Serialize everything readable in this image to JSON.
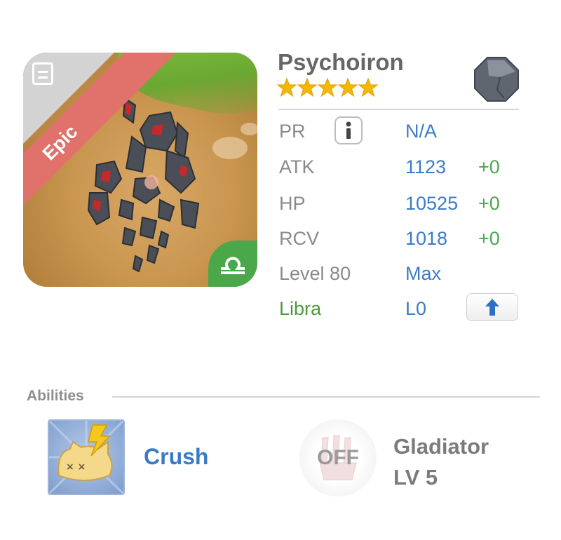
{
  "monster": {
    "name": "Psychoiron",
    "rarity": "Epic",
    "stars": 5,
    "element_icon": "stone-element-icon",
    "zodiac_icon": "libra-icon"
  },
  "stats": {
    "pr": {
      "label": "PR",
      "value": "N/A"
    },
    "atk": {
      "label": "ATK",
      "value": "1123",
      "bonus": "+0"
    },
    "hp": {
      "label": "HP",
      "value": "10525",
      "bonus": "+0"
    },
    "rcv": {
      "label": "RCV",
      "value": "1018",
      "bonus": "+0"
    },
    "level": {
      "label": "Level 80",
      "value": "Max"
    },
    "zodiac": {
      "label": "Libra",
      "value": "L0"
    }
  },
  "abilities": {
    "title": "Abilities",
    "active": {
      "name": "Crush"
    },
    "passive": {
      "status": "OFF",
      "name": "Gladiator",
      "level": "LV 5"
    }
  },
  "colors": {
    "value_blue": "#3a7bc8",
    "bonus_green": "#4fa64f",
    "zodiac_green": "#4a9a3a",
    "epic_red": "#e0716b",
    "star_gold": "#f5b800"
  }
}
